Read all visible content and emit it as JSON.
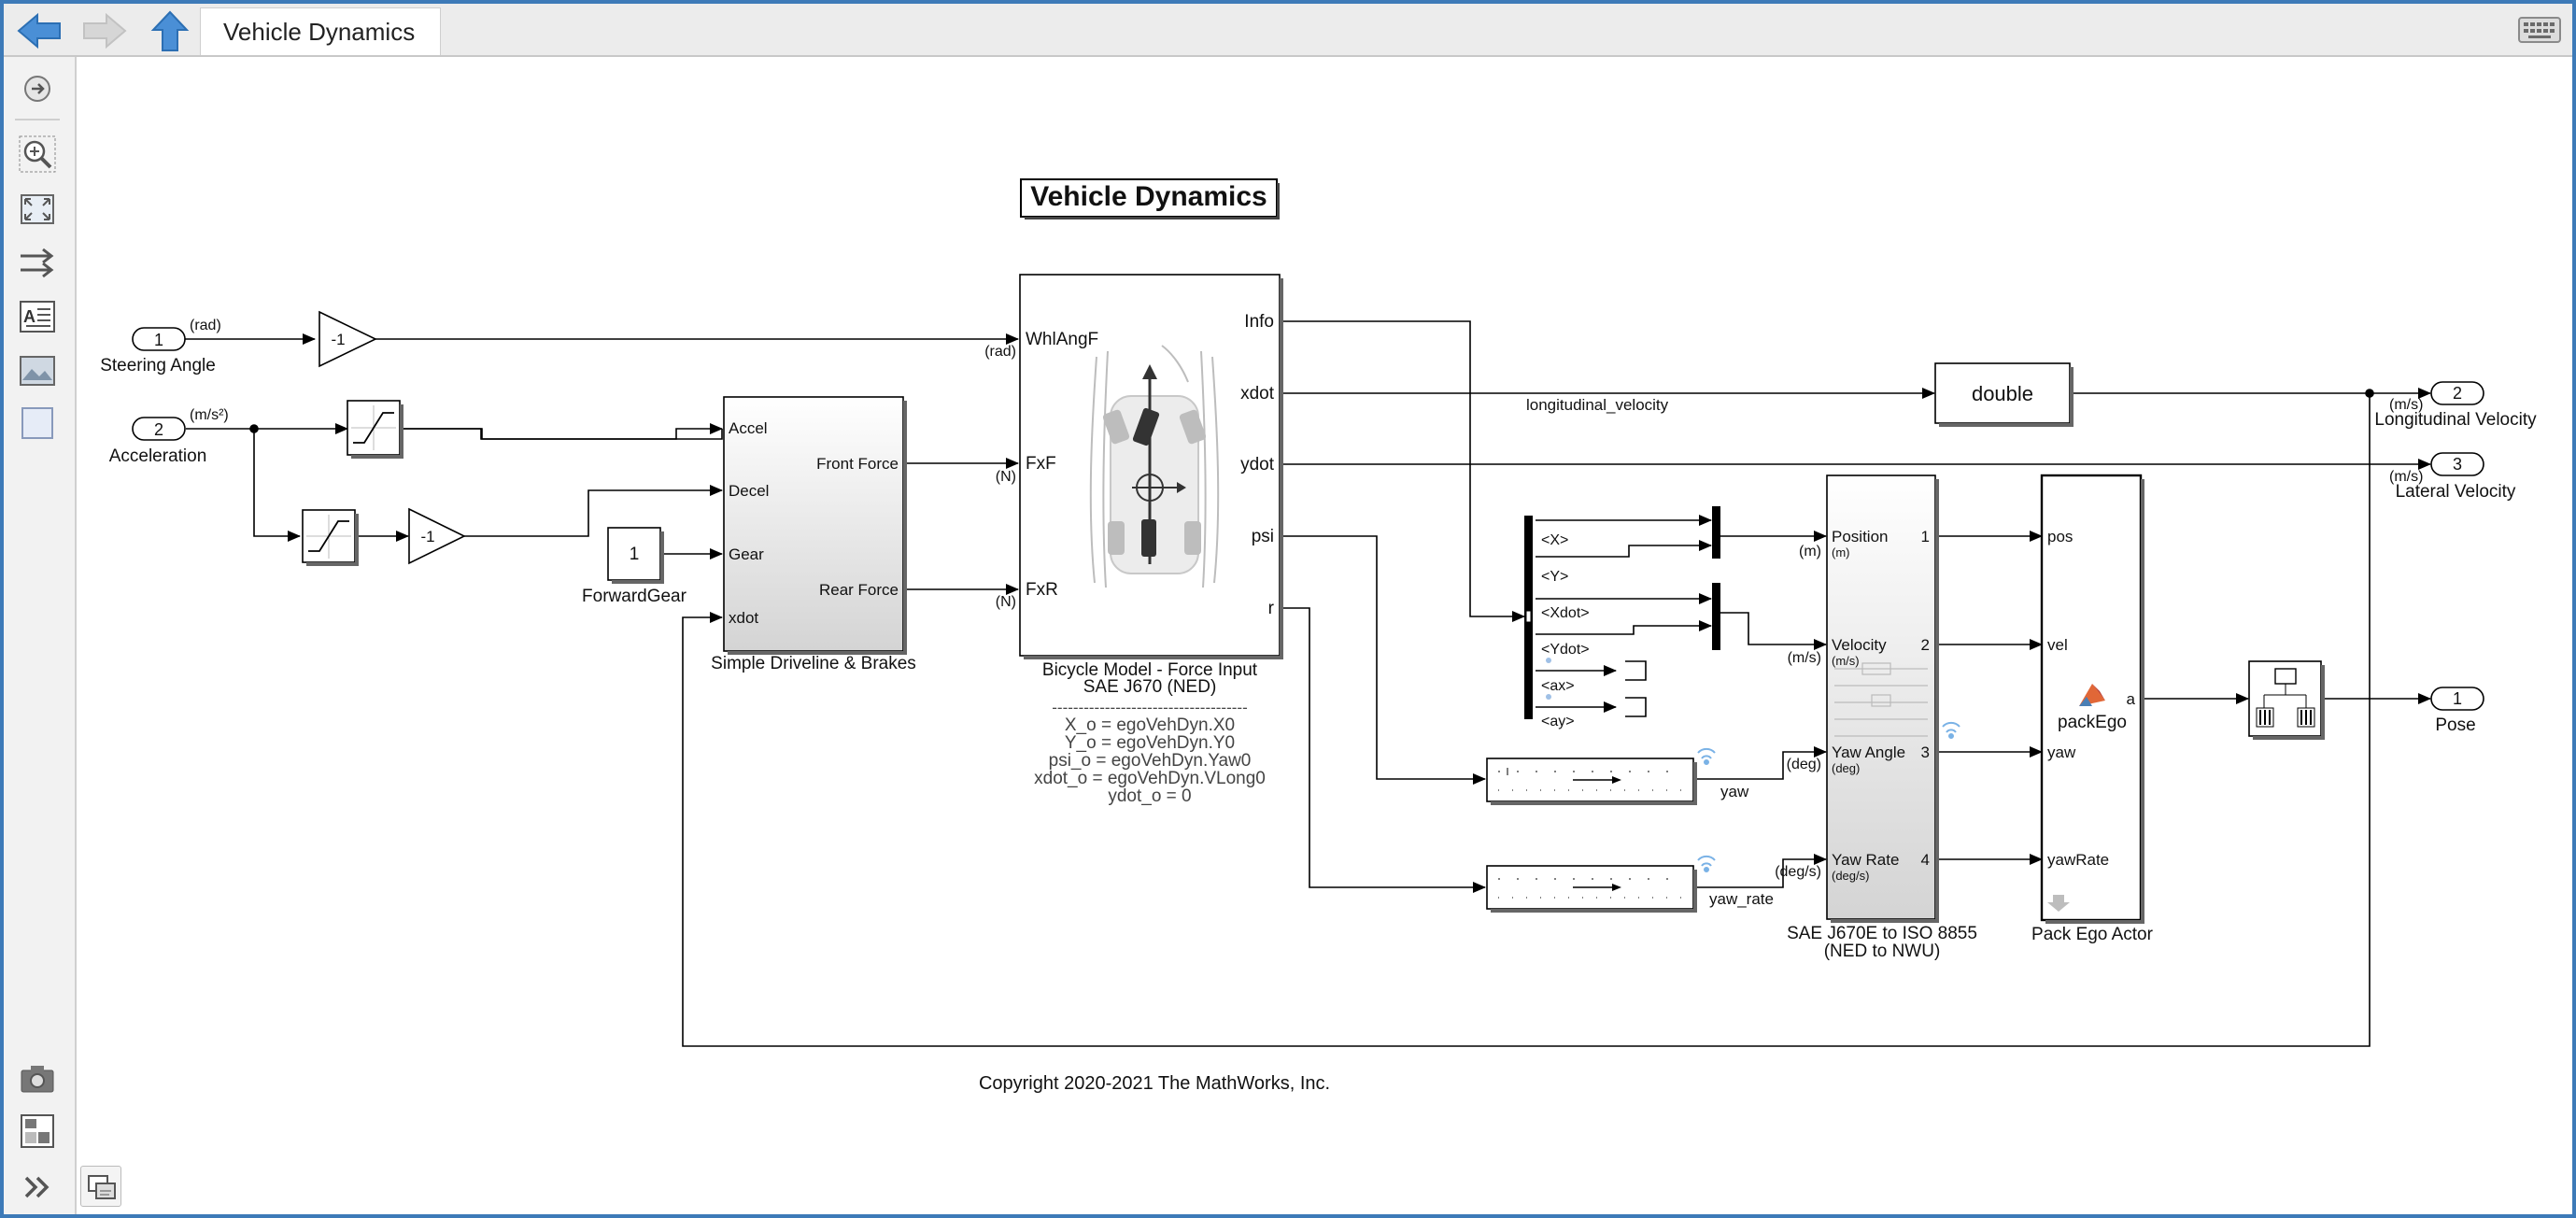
{
  "toolbar": {
    "breadcrumb_tab": "Vehicle Dynamics",
    "back_icon": "arrow-left-icon",
    "forward_icon": "arrow-right-icon",
    "up_icon": "arrow-up-icon",
    "keyboard_icon": "keyboard-icon"
  },
  "sidebar": {
    "icons": [
      "hide-explorer-icon",
      "zoom-icon",
      "fit-to-view-icon",
      "signal-flow-icon",
      "annotation-icon",
      "image-icon",
      "area-icon",
      "camera-icon",
      "model-browser-icon",
      "expand-icon"
    ]
  },
  "model": {
    "title": "Vehicle Dynamics",
    "copyright": "Copyright 2020-2021 The MathWorks, Inc.",
    "inports": [
      {
        "number": "1",
        "name": "Steering Angle",
        "unit": "(rad)"
      },
      {
        "number": "2",
        "name": "Acceleration",
        "unit": "(m/s²)"
      }
    ],
    "outports": [
      {
        "number": "2",
        "name": "Longitudinal Velocity",
        "unit": "(m/s)"
      },
      {
        "number": "3",
        "name": "Lateral Velocity",
        "unit": "(m/s)"
      },
      {
        "number": "1",
        "name": "Pose"
      }
    ],
    "gain_value": "-1",
    "constant": {
      "value": "1",
      "name": "ForwardGear"
    },
    "driveline": {
      "name": "Simple Driveline & Brakes",
      "inputs": [
        "Accel",
        "Decel",
        "Gear",
        "xdot"
      ],
      "outputs": [
        "Front Force",
        "Rear Force"
      ]
    },
    "bicycle": {
      "name_line1": "Bicycle Model - Force Input",
      "name_line2": "SAE J670 (NED)",
      "inputs": [
        "WhlAngF",
        "FxF",
        "FxR"
      ],
      "input_units": [
        "(rad)",
        "(N)",
        "(N)"
      ],
      "outputs": [
        "Info",
        "xdot",
        "ydot",
        "psi",
        "r"
      ],
      "separator": "-------------------------------------",
      "params": [
        "X_o = egoVehDyn.X0",
        "Y_o = egoVehDyn.Y0",
        "psi_o = egoVehDyn.Yaw0",
        "xdot_o = egoVehDyn.VLong0",
        "ydot_o = 0"
      ]
    },
    "signal_longitudinal": "longitudinal_velocity",
    "conversion": "double",
    "bus_elements": [
      "<X>",
      "<Y>",
      "<Xdot>",
      "<Ydot>",
      "<ax>",
      "<ay>"
    ],
    "unit_conversion_labels": [
      "yaw",
      "yaw_rate"
    ],
    "sae": {
      "name_line1": "SAE J670E to ISO 8855",
      "name_line2": "(NED to NWU)",
      "inputs": [
        "Position",
        "Velocity",
        "Yaw Angle",
        "Yaw Rate"
      ],
      "input_units": [
        "(m)",
        "(m/s)",
        "(deg)",
        "(deg/s)"
      ],
      "outputs": [
        "1",
        "2",
        "3",
        "4"
      ],
      "signal_units": [
        "(m)",
        "(m/s)",
        "(deg)",
        "(deg/s)"
      ]
    },
    "pack": {
      "name": "Pack Ego Actor",
      "function": "packEgo",
      "inputs": [
        "pos",
        "vel",
        "yaw",
        "yawRate"
      ],
      "output": "a"
    }
  }
}
